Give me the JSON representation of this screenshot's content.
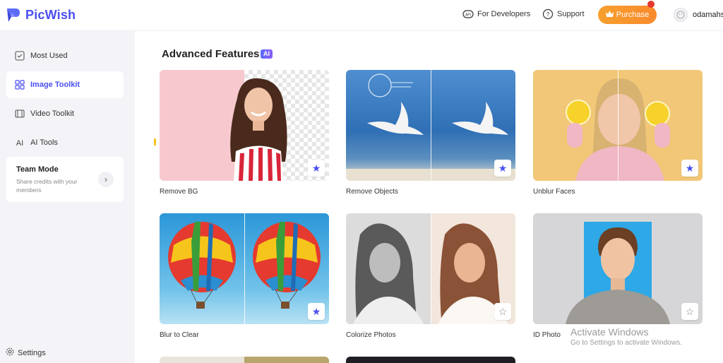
{
  "app": {
    "name": "PicWish",
    "brand_color": "#4b4ff0",
    "accent_color": "#f7a02d"
  },
  "header": {
    "developers_label": "For Developers",
    "support_label": "Support",
    "purchase_label": "Purchase",
    "username": "odamahs"
  },
  "sidebar": {
    "items": [
      {
        "label": "Most Used",
        "icon": "clock-icon"
      },
      {
        "label": "Image Toolkit",
        "icon": "grid-icon",
        "active": true
      },
      {
        "label": "Video Toolkit",
        "icon": "film-icon"
      },
      {
        "label": "AI Tools",
        "icon": "ai-icon"
      }
    ],
    "team": {
      "title": "Team Mode",
      "description": "Share credits with your members"
    },
    "settings_label": "Settings"
  },
  "main": {
    "section_title": "Advanced Features",
    "badge": "AI",
    "cards": [
      {
        "label": "Remove BG",
        "favorited": true
      },
      {
        "label": "Remove Objects",
        "favorited": true
      },
      {
        "label": "Unblur Faces",
        "favorited": true
      },
      {
        "label": "Blur to Clear",
        "favorited": true
      },
      {
        "label": "Colorize Photos",
        "favorited": false
      },
      {
        "label": "ID Photo",
        "favorited": false
      }
    ]
  },
  "watermark": {
    "title": "Activate Windows",
    "subtitle": "Go to Settings to activate Windows."
  }
}
